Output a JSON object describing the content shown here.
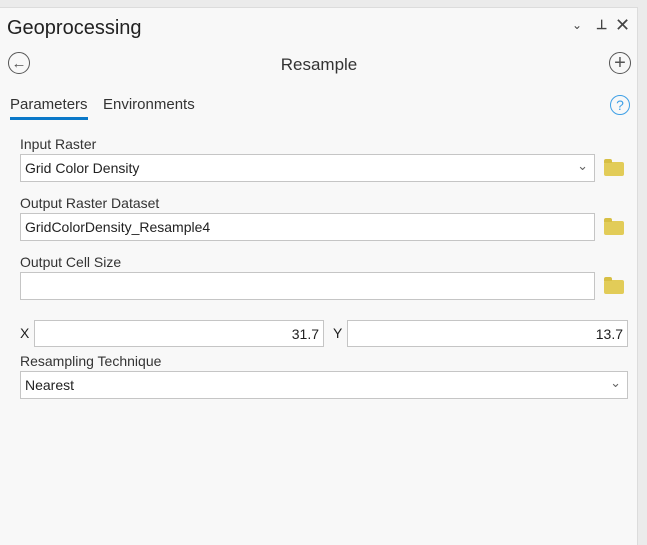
{
  "pane": {
    "title": "Geoprocessing",
    "tool_title": "Resample"
  },
  "tabs": [
    {
      "label": "Parameters",
      "active": true
    },
    {
      "label": "Environments",
      "active": false
    }
  ],
  "params": {
    "input_raster": {
      "label": "Input Raster",
      "value": "Grid Color Density"
    },
    "output_raster": {
      "label": "Output Raster Dataset",
      "value": "GridColorDensity_Resample4"
    },
    "cell_size": {
      "label": "Output Cell Size",
      "value": "",
      "x_label": "X",
      "x_value": "31.7",
      "y_label": "Y",
      "y_value": "13.7"
    },
    "technique": {
      "label": "Resampling Technique",
      "value": "Nearest"
    }
  }
}
